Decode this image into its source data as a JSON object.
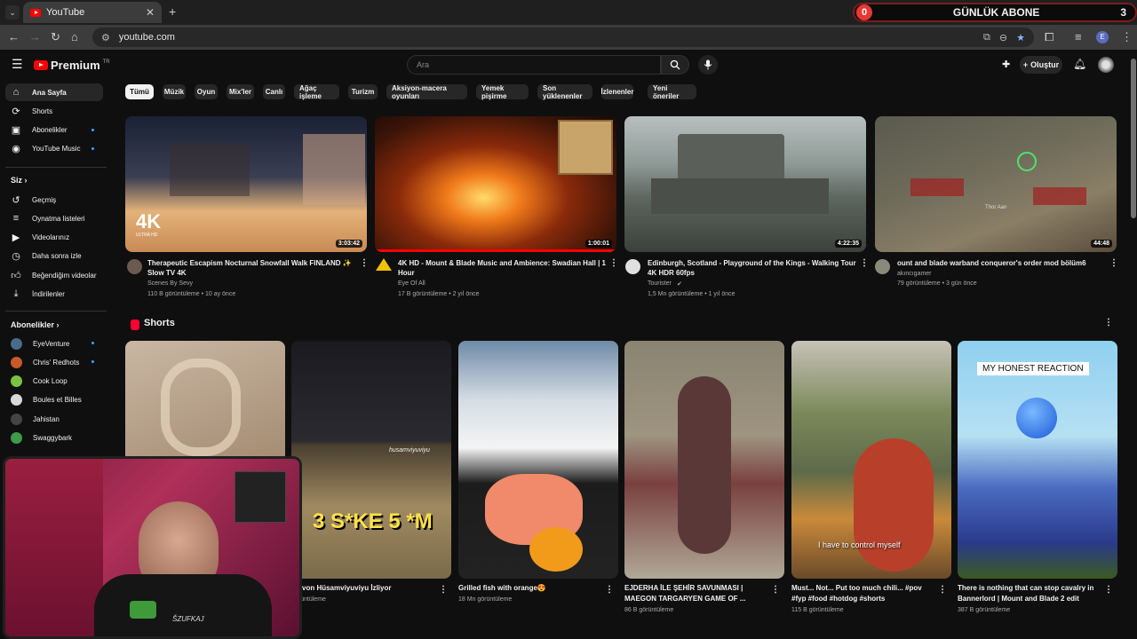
{
  "browser": {
    "tab_title": "YouTube",
    "url": "youtube.com",
    "profile_initial": "E"
  },
  "overlay": {
    "left_count": "0",
    "label": "GÜNLÜK ABONE",
    "right_count": "3"
  },
  "masthead": {
    "logo_text": "Premium",
    "region": "TR",
    "search_placeholder": "Ara",
    "create_label": "Oluştur"
  },
  "sidebar": {
    "main": [
      {
        "label": "Ana Sayfa",
        "icon": "home-icon"
      },
      {
        "label": "Shorts",
        "icon": "shorts-icon"
      },
      {
        "label": "Abonelikler",
        "icon": "subscriptions-icon"
      },
      {
        "label": "YouTube Music",
        "icon": "music-icon"
      }
    ],
    "you_heading": "Siz",
    "you": [
      {
        "label": "Geçmiş",
        "icon": "history-icon"
      },
      {
        "label": "Oynatma listeleri",
        "icon": "playlist-icon"
      },
      {
        "label": "Videolarınız",
        "icon": "video-icon"
      },
      {
        "label": "Daha sonra izle",
        "icon": "clock-icon"
      },
      {
        "label": "Beğendiğim videolar",
        "icon": "thumbs-up-icon"
      },
      {
        "label": "İndirilenler",
        "icon": "download-icon"
      }
    ],
    "subs_heading": "Abonelikler",
    "subs": [
      {
        "label": "EyeVenture",
        "color": "#4a6b8a"
      },
      {
        "label": "Chris' Redhots",
        "color": "#c75a2a"
      },
      {
        "label": "Cook Loop",
        "color": "#7cc242"
      },
      {
        "label": "Boules et Billes",
        "color": "#d8d8d8"
      },
      {
        "label": "Jahistan",
        "color": "#444444"
      },
      {
        "label": "Swaggybark",
        "color": "#3f9a4a"
      }
    ]
  },
  "chips": [
    "Tümü",
    "Müzik",
    "Oyun",
    "Mix'ler",
    "Canlı",
    "Ağaç işleme",
    "Turizm",
    "Aksiyon-macera oyunları",
    "Yemek pişirme",
    "Son yüklenenler",
    "İzlenenler",
    "Yeni öneriler"
  ],
  "videos": [
    {
      "title": "Therapeutic Escapism Nocturnal Snowfall Walk FINLAND ✨ Slow TV 4K",
      "channel": "Scenes By Sevy",
      "stats": "110 B görüntüleme • 10 ay önce",
      "duration": "3:03:42",
      "badge": "4K",
      "badge_sub": "ULTRA HD"
    },
    {
      "title": "4K HD - Mount & Blade Music and Ambience: Swadian Hall | 1 Hour",
      "channel": "Eye Of All",
      "stats": "17 B görüntüleme • 2 yıl önce",
      "duration": "1:00:01"
    },
    {
      "title": "Edinburgh, Scotland - Playground of the Kings - Walking Tour 4K HDR 60fps",
      "channel": "Tourister",
      "stats": "1,5 Mn görüntüleme • 1 yıl önce",
      "duration": "4:22:35"
    },
    {
      "title": "ount and blade warband conqueror's order mod bölüm6",
      "channel": "akıncıgamer",
      "stats": "79 görüntüleme • 3 gün önce",
      "duration": "44:48",
      "overlay_text": "Thor Aan"
    }
  ],
  "shorts_heading": "Shorts",
  "shorts": [
    {
      "title": "",
      "views": ""
    },
    {
      "title": "univon Hüsamviyuviyu İzliyor",
      "views": "görüntüleme",
      "caption": "3 S*KE 5 *M",
      "handle": "husamviyuviyu"
    },
    {
      "title": "Grilled fish with orange😍",
      "views": "18 Mn görüntüleme"
    },
    {
      "title": "EJDERHA İLE ŞEHİR SAVUNMASI | MAEGON TARGARYEN GAME OF ...",
      "views": "86 B görüntüleme"
    },
    {
      "title": "Must... Not... Put too much chili... #pov #fyp #food #hotdog #shorts",
      "views": "115 B görüntüleme",
      "caption": "I have to control myself"
    },
    {
      "title": "There is nothing that can stop cavalry in Bannerlord | Mount and Blade 2 edit",
      "views": "387 B görüntüleme",
      "caption": "MY HONEST REACTION"
    }
  ],
  "webcam": {
    "logo_text": "ŠZUFKAJ"
  }
}
